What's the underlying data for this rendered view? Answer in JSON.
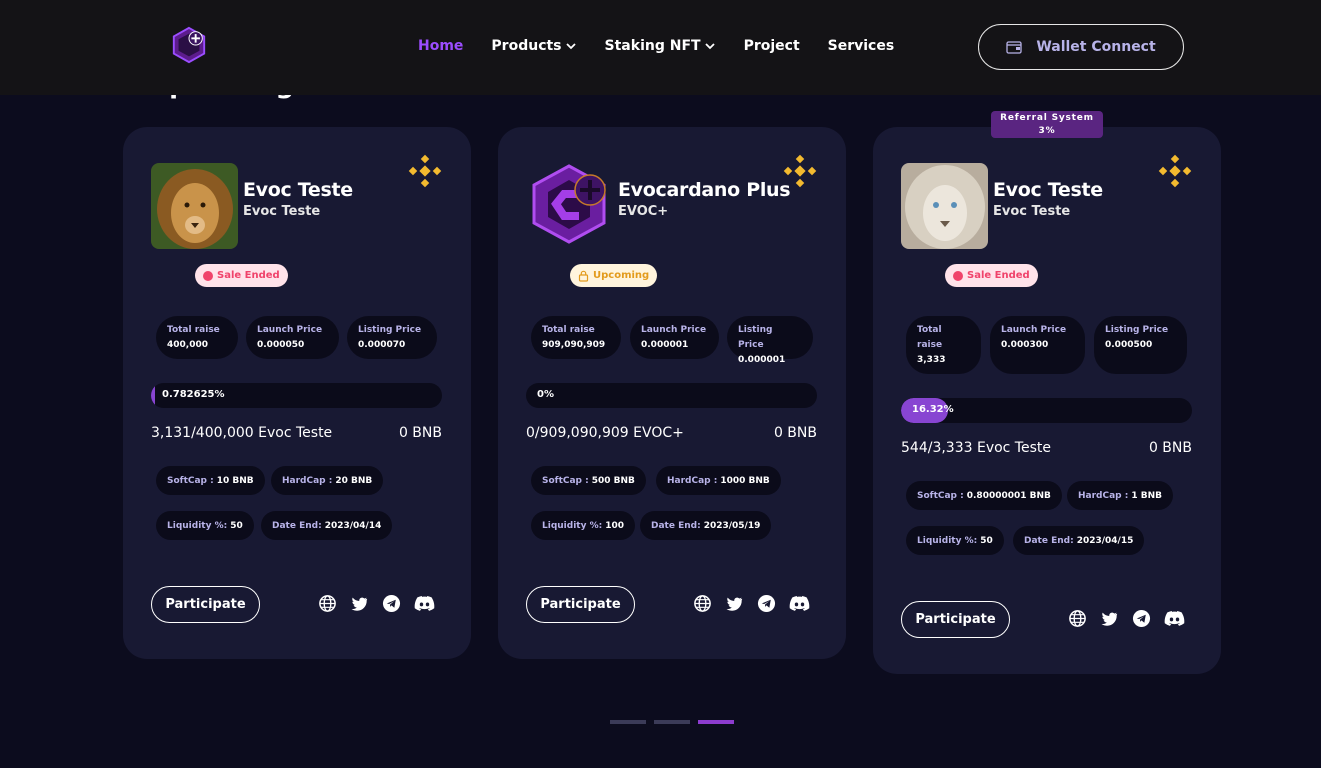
{
  "nav": {
    "items": [
      "Home",
      "Products",
      "Staking NFT",
      "Project",
      "Services"
    ],
    "wallet_label": "Wallet Connect"
  },
  "section_title_partial": "Upcoming",
  "cards": [
    {
      "title": "Evoc Teste",
      "subtitle": "Evoc Teste",
      "status": "Sale Ended",
      "stats": [
        {
          "label": "Total raise",
          "value": "400,000"
        },
        {
          "label": "Launch Price",
          "value": "0.000050"
        },
        {
          "label": "Listing Price",
          "value": "0.000070"
        }
      ],
      "progress_label": "0.782625%",
      "progress_percent": 0.782625,
      "raised": "3,131/400,000 Evoc Teste",
      "raised_bnb": "0 BNB",
      "softcap_label": "SoftCap :",
      "softcap_value": "10 BNB",
      "hardcap_label": "HardCap :",
      "hardcap_value": "20 BNB",
      "liquidity_label": "Liquidity %:",
      "liquidity_value": "50",
      "date_label": "Date End:",
      "date_value": "2023/04/14",
      "participate": "Participate"
    },
    {
      "title": "Evocardano Plus",
      "subtitle": "EVOC+",
      "status": "Upcoming",
      "stats": [
        {
          "label": "Total raise",
          "value": "909,090,909"
        },
        {
          "label": "Launch Price",
          "value": "0.000001"
        },
        {
          "label": "Listing Price",
          "value": "0.000001"
        }
      ],
      "progress_label": "0%",
      "progress_percent": 0,
      "raised": "0/909,090,909 EVOC+",
      "raised_bnb": "0 BNB",
      "softcap_label": "SoftCap :",
      "softcap_value": "500 BNB",
      "hardcap_label": "HardCap :",
      "hardcap_value": "1000 BNB",
      "liquidity_label": "Liquidity %:",
      "liquidity_value": "100",
      "date_label": "Date End:",
      "date_value": "2023/05/19",
      "participate": "Participate"
    },
    {
      "title": "Evoc Teste",
      "subtitle": "Evoc Teste",
      "status": "Sale Ended",
      "referral_line1": "Referral System",
      "referral_line2": "3%",
      "stats": [
        {
          "label": "Total raise",
          "value": "3,333"
        },
        {
          "label": "Launch Price",
          "value": "0.000300"
        },
        {
          "label": "Listing Price",
          "value": "0.000500"
        }
      ],
      "progress_label": "16.32%",
      "progress_percent": 16.32,
      "raised": "544/3,333 Evoc Teste",
      "raised_bnb": "0 BNB",
      "softcap_label": "SoftCap :",
      "softcap_value": "0.80000001 BNB",
      "hardcap_label": "HardCap :",
      "hardcap_value": "1 BNB",
      "liquidity_label": "Liquidity %:",
      "liquidity_value": "50",
      "date_label": "Date End:",
      "date_value": "2023/04/15",
      "participate": "Participate"
    }
  ],
  "colors": {
    "accent": "#9b4dff",
    "card_bg": "#181933",
    "page_bg": "#0c0c1e",
    "progress_fill": "#8845d2",
    "binance": "#f3ba2f"
  },
  "icons": [
    "globe-icon",
    "twitter-icon",
    "telegram-icon",
    "discord-icon",
    "binance-icon",
    "wallet-icon",
    "chevron-down-icon",
    "lock-icon"
  ]
}
